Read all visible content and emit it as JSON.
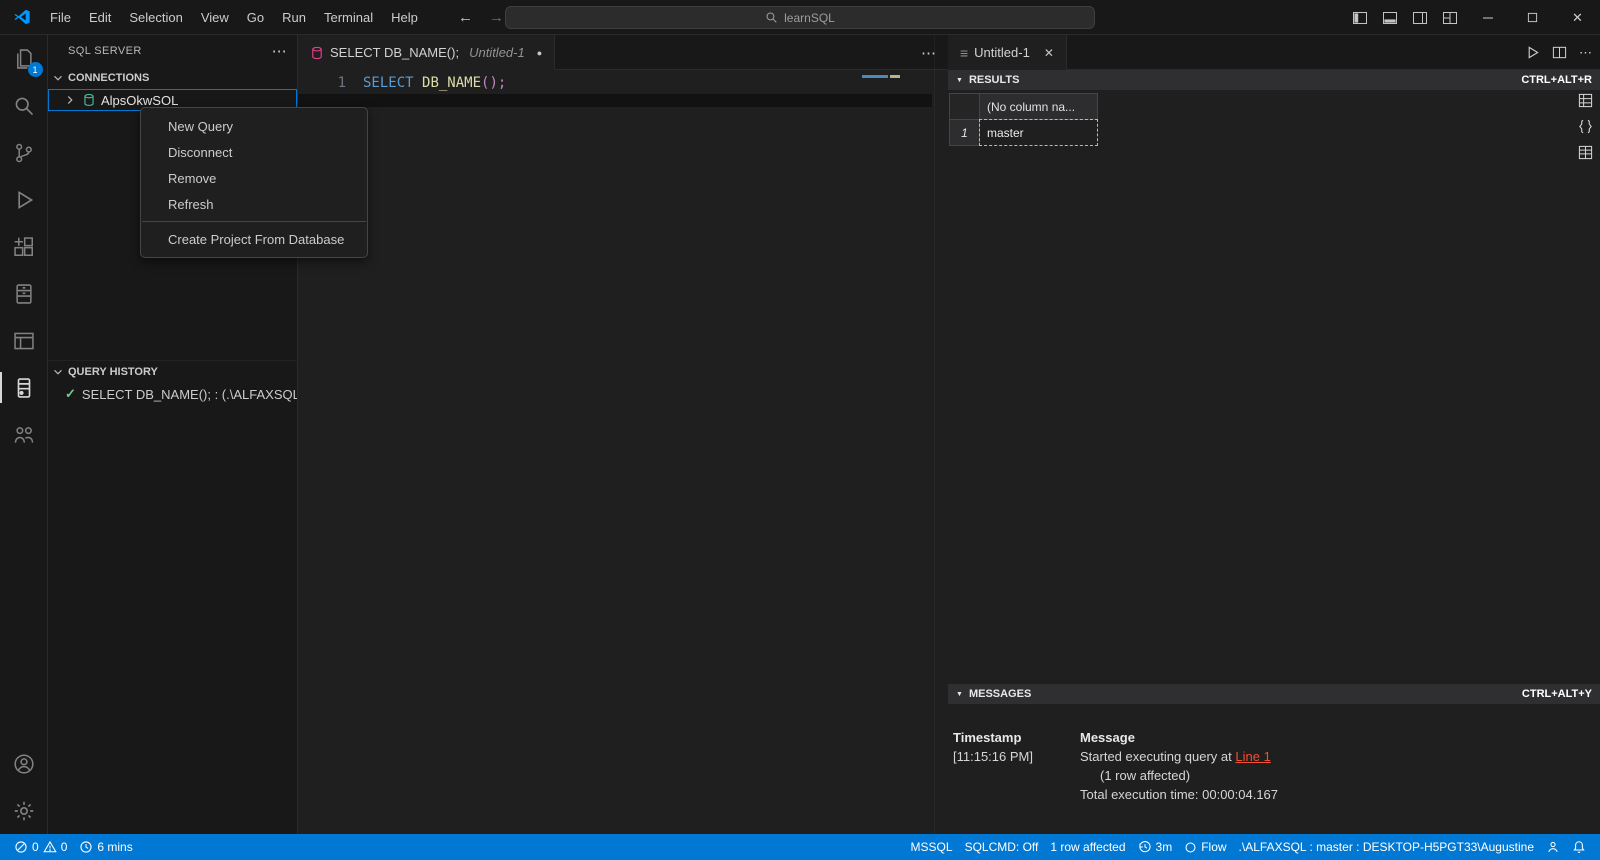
{
  "colors": {
    "accent": "#0078d4",
    "statusbar_background": "#0078d4",
    "keyword": "#569cd6",
    "function": "#dcdcaa",
    "bracket": "#c586c0",
    "message_link": "#f05133",
    "history_check": "#73c991"
  },
  "title_bar": {
    "menus": [
      "File",
      "Edit",
      "Selection",
      "View",
      "Go",
      "Run",
      "Terminal",
      "Help"
    ],
    "search_text": "learnSQL"
  },
  "activity_bar": {
    "explorer_badge": "1"
  },
  "sidebar": {
    "title": "SQL SERVER",
    "more_actions": "⋯",
    "connections_label": "CONNECTIONS",
    "connection_name": "AlpsOkwSOL",
    "history_label": "QUERY HISTORY",
    "history_item": "SELECT DB_NAME(); : (.\\ALFAXSQL|...",
    "history_check": "✓"
  },
  "context_menu": {
    "items": [
      "New Query",
      "Disconnect",
      "Remove",
      "Refresh",
      "Create Project From Database"
    ]
  },
  "editor": {
    "tab_title": "SELECT DB_NAME();",
    "tab_subtitle": "Untitled-1",
    "modified_dot": "●",
    "more_actions": "⋯",
    "line_number": "1",
    "code_keyword": "SELECT",
    "code_function": "DB_NAME",
    "code_punct": "();"
  },
  "results": {
    "tab_title": "Untitled-1",
    "tab_close": "✕",
    "more_actions": "⋯",
    "header_label": "RESULTS",
    "header_shortcut": "CTRL+ALT+R",
    "collapse_glyph": "▼",
    "grid_column": "(No column na...",
    "row_number": "1",
    "row_value": "master",
    "messages_label": "MESSAGES",
    "messages_shortcut": "CTRL+ALT+Y",
    "msg_col1": "Timestamp",
    "msg_col2": "Message",
    "msg_timestamp": "[11:15:16 PM]",
    "msg_line1_prefix": "Started executing query at ",
    "msg_line1_link": "Line 1",
    "msg_line2": "(1 row affected)",
    "msg_line3": "Total execution time: 00:00:04.167"
  },
  "status_bar": {
    "errors": "0",
    "warnings": "0",
    "session_time": "6 mins",
    "mssql": "MSSQL",
    "sqlcmd": "SQLCMD: Off",
    "rows_affected": "1 row affected",
    "timer": "3m",
    "flow": "Flow",
    "connection": ".\\ALFAXSQL : master : DESKTOP-H5PGT33\\Augustine"
  }
}
